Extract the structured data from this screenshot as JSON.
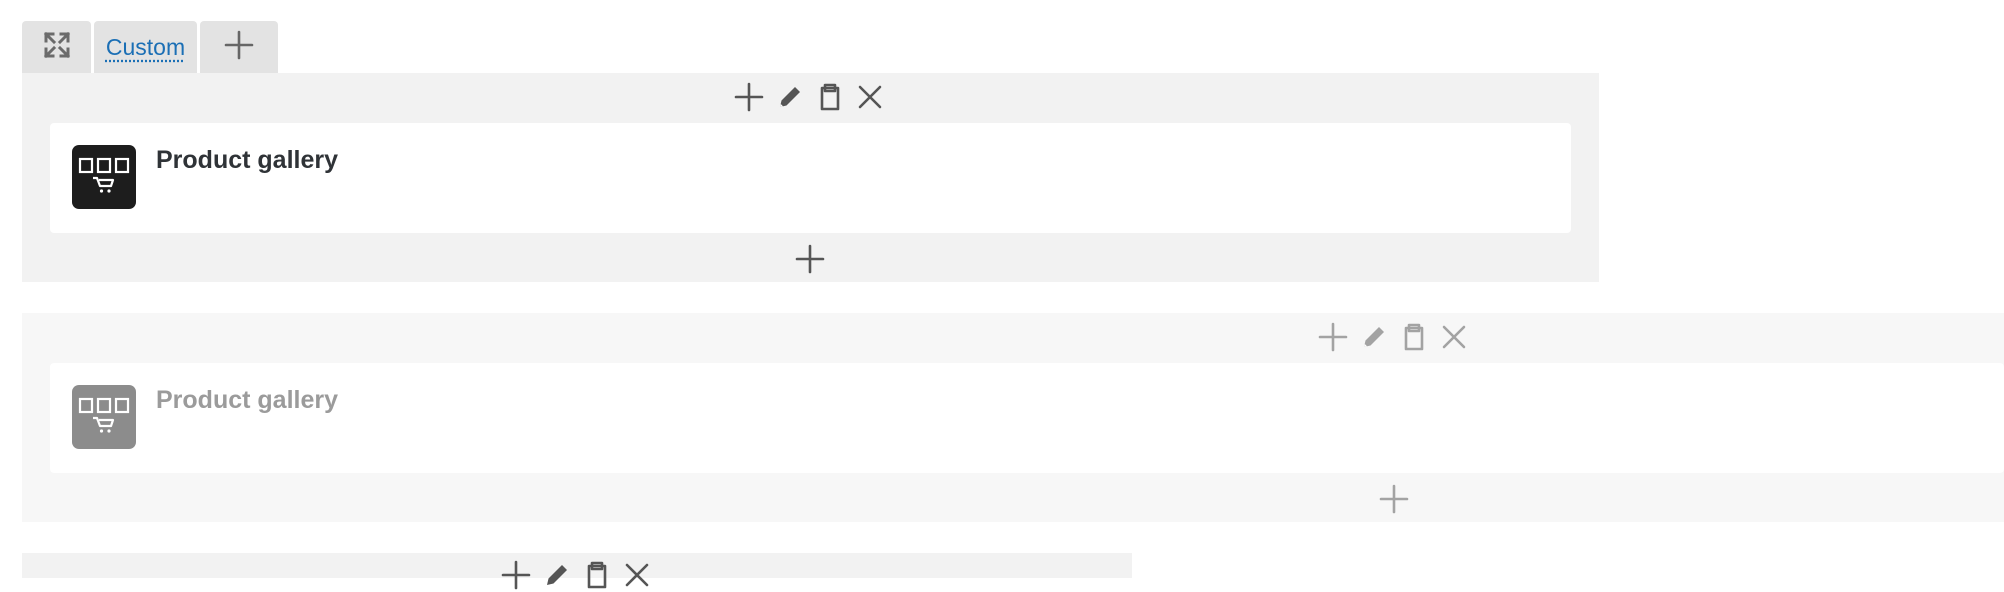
{
  "tabs": {
    "active_label": "Custom",
    "items": [
      {
        "icon": "fullscreen-expand-icon"
      },
      {
        "label_ref": "Custom"
      },
      {
        "icon": "plus-icon"
      }
    ]
  },
  "toolbar_icons": [
    "plus-icon",
    "pencil-icon",
    "clipboard-icon",
    "close-icon"
  ],
  "blocks": [
    {
      "title": "Product gallery",
      "state": "active",
      "icon": "product-gallery-icon"
    },
    {
      "title": "Product gallery",
      "state": "inactive",
      "icon": "product-gallery-icon"
    }
  ],
  "colors": {
    "panel_active": "#f2f2f2",
    "panel_inactive": "#f7f7f7",
    "icon_active": "#555555",
    "icon_inactive": "#a3a3a3",
    "title_active": "#2f3337",
    "title_inactive": "#9b9b9b",
    "link": "#1b6fb5"
  }
}
